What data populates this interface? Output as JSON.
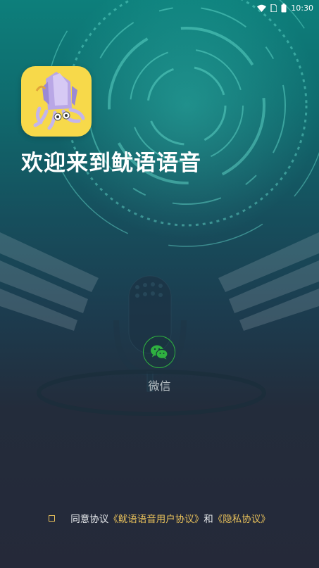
{
  "status_bar": {
    "time": "10:30"
  },
  "app": {
    "logo_icon": "squid-logo-icon",
    "welcome_text": "欢迎来到鱿语语音"
  },
  "wechat_login": {
    "icon": "wechat-icon",
    "label": "微信"
  },
  "agreement": {
    "prefix": "同意协议",
    "user_agreement_link": "《鱿语语音用户协议》",
    "conjunction": "和",
    "privacy_link": "《隐私协议》"
  },
  "colors": {
    "accent": "#e8c15b",
    "wechat_green": "#2fb040",
    "logo_bg": "#f7d94a"
  }
}
